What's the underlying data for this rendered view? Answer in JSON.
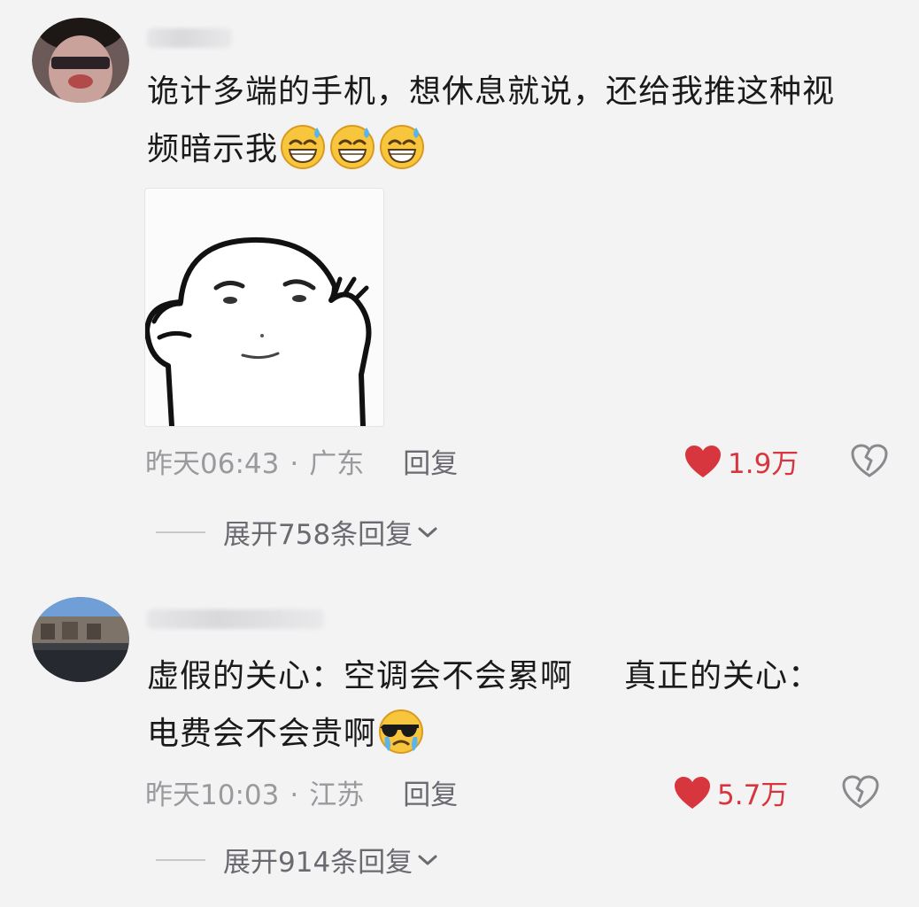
{
  "comments": [
    {
      "text_line1": "诡计多端的手机，想休息就说，还给我推这种视",
      "text_line2": "频暗示我",
      "emojis": [
        "grinning-sweat-face-emoji",
        "grinning-sweat-face-emoji",
        "grinning-sweat-face-emoji"
      ],
      "sticker": "cartoon-blob-sticker",
      "time": "昨天06:43",
      "separator": "·",
      "location": "广东",
      "reply_label": "回复",
      "likes": "1.9万",
      "expand_label": "展开758条回复"
    },
    {
      "text_line1_a": "虚假的关心：空调会不会累啊",
      "text_line1_b": "真正的关心：",
      "text_line2": "电费会不会贵啊",
      "emojis": [
        "sunglasses-crying-face-emoji"
      ],
      "time": "昨天10:03",
      "separator": "·",
      "location": "江苏",
      "reply_label": "回复",
      "likes": "5.7万",
      "expand_label": "展开914条回复"
    }
  ],
  "colors": {
    "background": "#f3f3f4",
    "like_red": "#d8363f",
    "meta_gray": "#9a9a9e"
  }
}
